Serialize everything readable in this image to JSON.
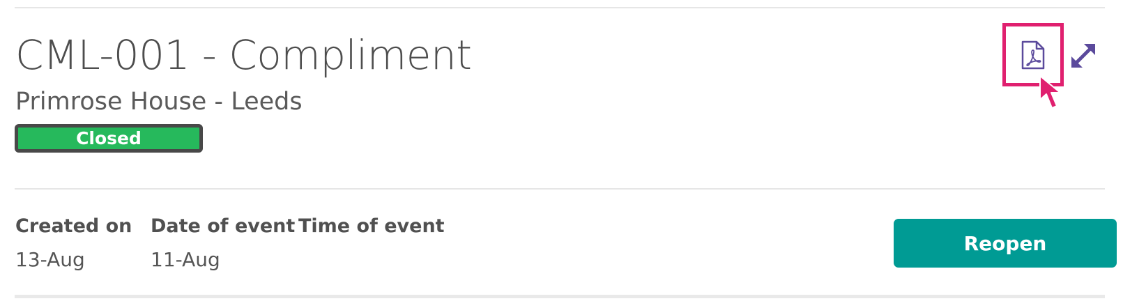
{
  "record": {
    "title": "CML-001 - Compliment",
    "location": "Primrose House - Leeds",
    "status": "Closed"
  },
  "details": {
    "created_on_label": "Created on",
    "created_on_value": "13-Aug",
    "date_of_event_label": "Date of event",
    "date_of_event_value": "11-Aug",
    "time_of_event_label": "Time of event"
  },
  "actions": {
    "reopen_label": "Reopen",
    "pdf_icon": "pdf-icon",
    "expand_icon": "expand-icon"
  },
  "colors": {
    "status_green": "#26b95c",
    "reopen_teal": "#009b94",
    "highlight_pink": "#e0206f",
    "icon_purple": "#5b4a9c"
  }
}
